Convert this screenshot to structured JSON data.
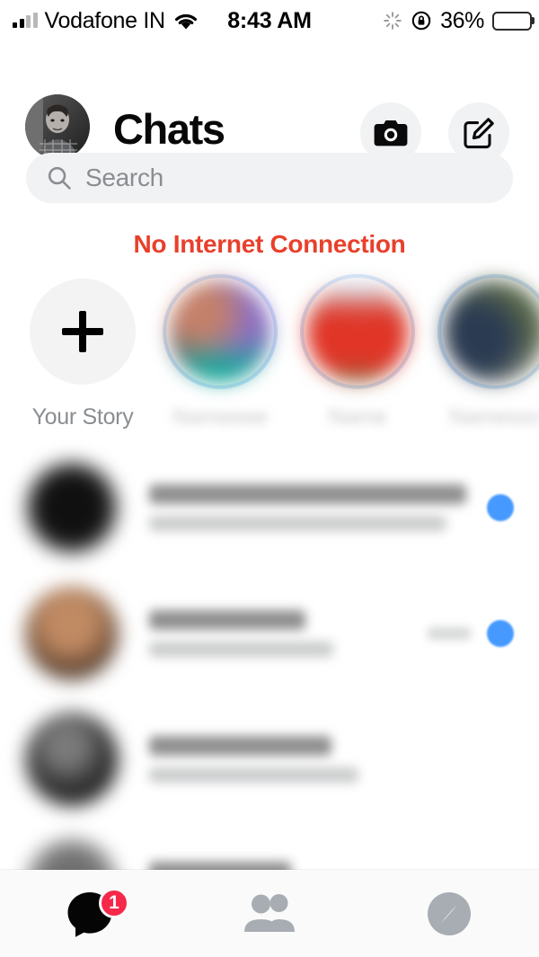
{
  "status_bar": {
    "carrier": "Vodafone IN",
    "signal_icon": "signal-bars-icon",
    "wifi_icon": "wifi-icon",
    "time": "8:43 AM",
    "activity_icon": "activity-spinner-icon",
    "rotation_lock_icon": "rotation-lock-icon",
    "battery_percent": "36%",
    "battery_icon": "battery-icon",
    "battery_level": 36,
    "battery_fill_color": "#fbc02d"
  },
  "header": {
    "title": "Chats",
    "avatar_icon": "profile-avatar",
    "camera_icon": "camera-icon",
    "compose_icon": "compose-icon"
  },
  "search": {
    "placeholder": "Search",
    "value": "",
    "icon": "search-icon"
  },
  "banner": {
    "text": "No Internet Connection",
    "color": "#e8402c"
  },
  "stories": {
    "items": [
      {
        "label": "Your Story",
        "type": "add",
        "icon": "plus-icon",
        "ring": false
      },
      {
        "label": "",
        "type": "story",
        "ring": true,
        "blurred": true
      },
      {
        "label": "",
        "type": "story",
        "ring": true,
        "blurred": true
      },
      {
        "label": "",
        "type": "story",
        "ring": true,
        "blurred": true
      }
    ]
  },
  "chats": {
    "rows": [
      {
        "name": "",
        "preview": "",
        "time": "",
        "unread": true,
        "blurred": true
      },
      {
        "name": "",
        "preview": "",
        "time": "",
        "unread": true,
        "blurred": true
      },
      {
        "name": "",
        "preview": "",
        "time": "",
        "unread": false,
        "blurred": true
      },
      {
        "name": "",
        "preview": "",
        "time": "",
        "unread": false,
        "blurred": true
      }
    ]
  },
  "tabbar": {
    "tabs": [
      {
        "name": "chats",
        "icon": "chat-bubble-icon",
        "active": true,
        "badge": "1"
      },
      {
        "name": "people",
        "icon": "people-icon",
        "active": false,
        "badge": ""
      },
      {
        "name": "discover",
        "icon": "compass-icon",
        "active": false,
        "badge": ""
      }
    ],
    "badge_color": "#f5284a"
  }
}
